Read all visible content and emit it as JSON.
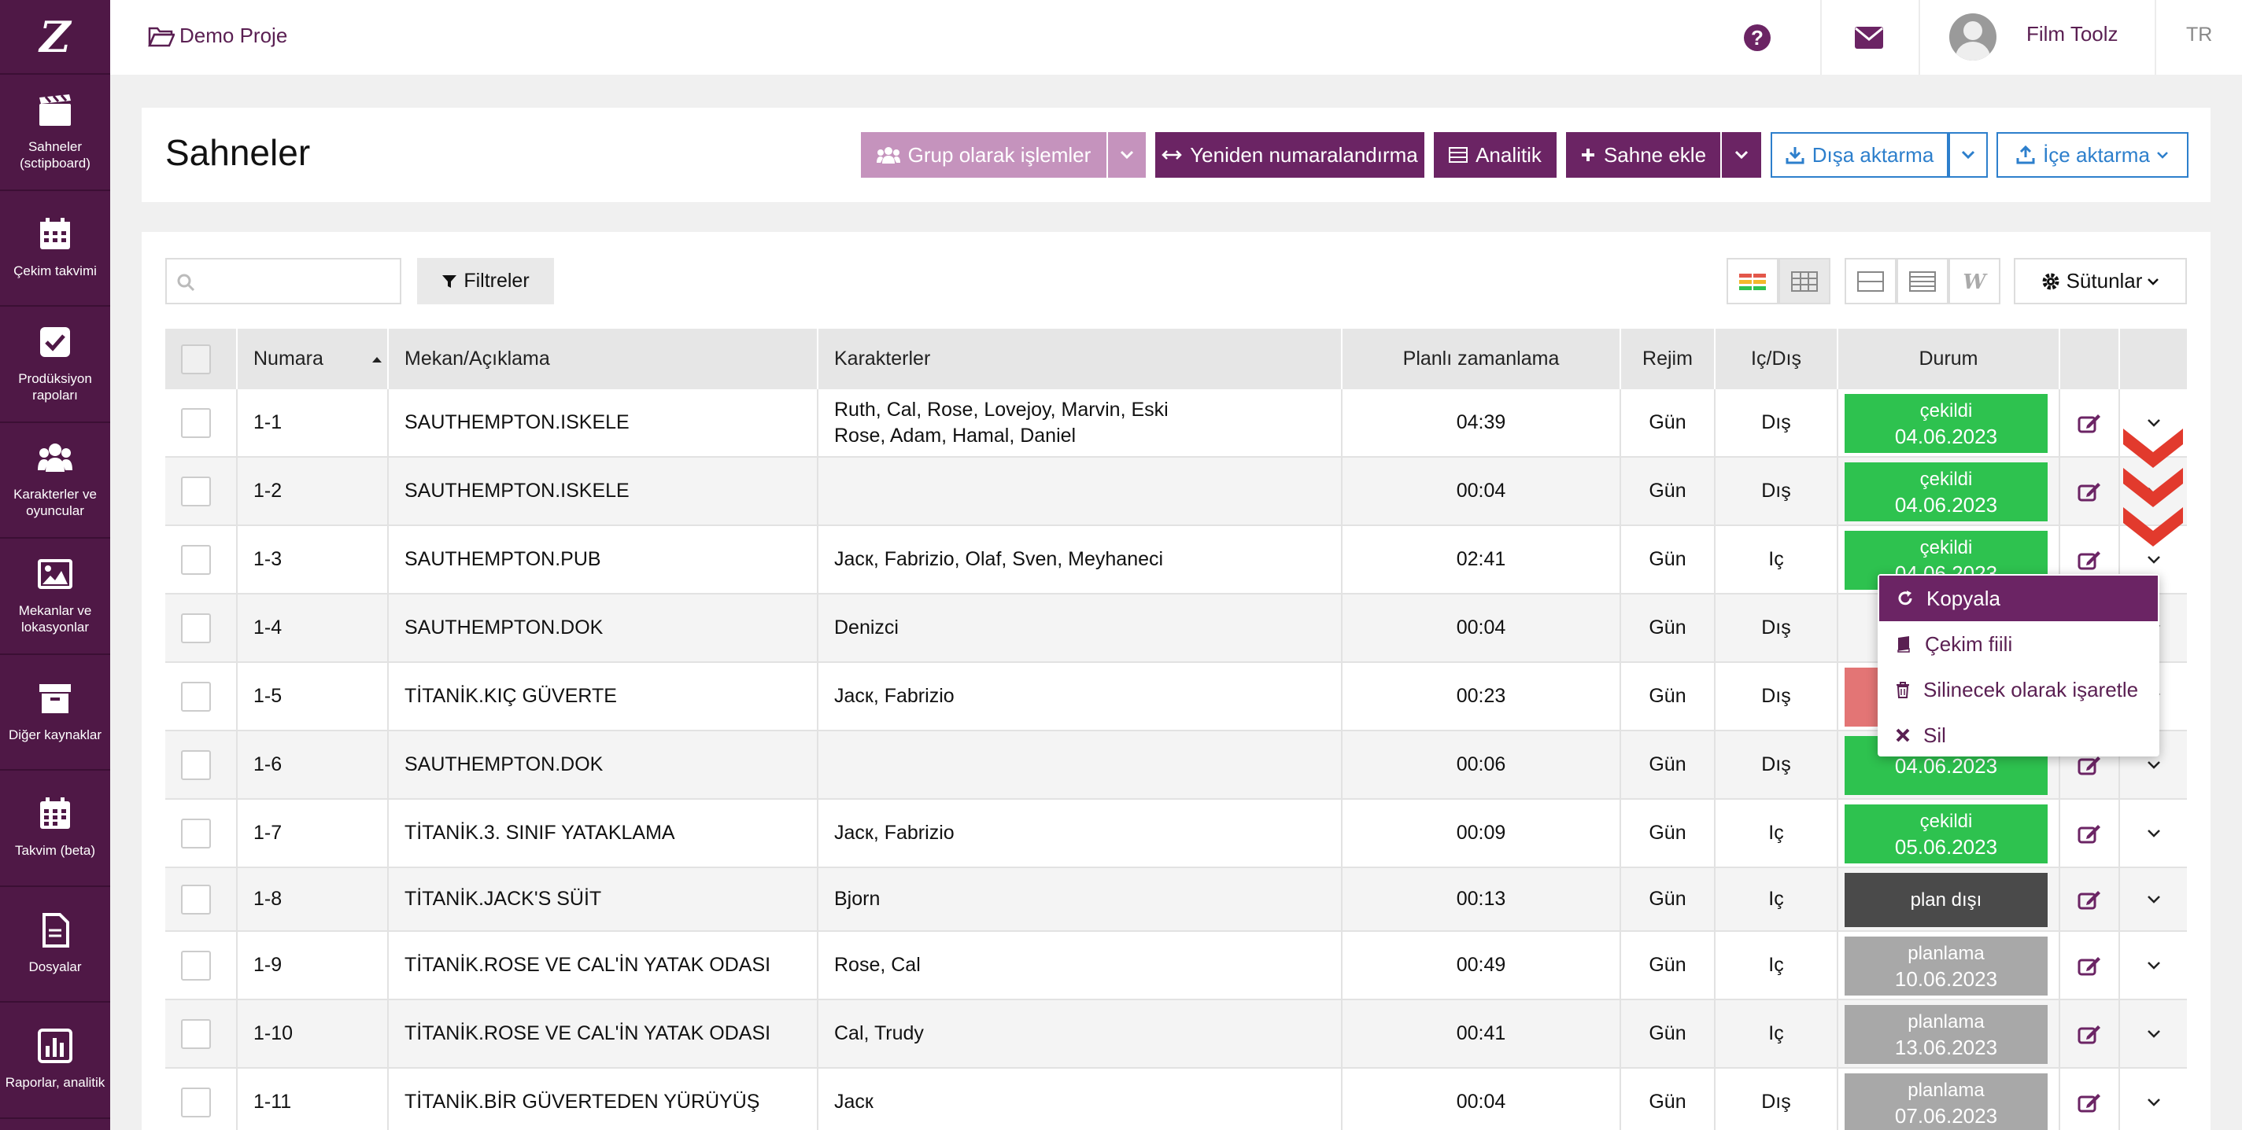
{
  "sidebar": {
    "logo": "Z",
    "items": [
      {
        "label": "Sahneler (sctipboard)",
        "icon": "clapperboard-icon"
      },
      {
        "label": "Çekim takvimi",
        "icon": "calendar-icon"
      },
      {
        "label": "Prodüksiyon rapoları",
        "icon": "checkbox-icon"
      },
      {
        "label": "Karakterler ve oyuncular",
        "icon": "users-icon"
      },
      {
        "label": "Mekanlar ve lokasyonlar",
        "icon": "image-icon"
      },
      {
        "label": "Diğer kaynaklar",
        "icon": "archive-icon"
      },
      {
        "label": "Takvim (beta)",
        "icon": "calendar-grid-icon"
      },
      {
        "label": "Dosyalar",
        "icon": "file-icon"
      },
      {
        "label": "Raporlar, analitik",
        "icon": "bar-chart-icon"
      }
    ]
  },
  "topbar": {
    "project": "Demo Proje",
    "user": "Film Toolz",
    "lang": "TR"
  },
  "header": {
    "title": "Sahneler",
    "group_ops": "Grup olarak işlemler",
    "renumber": "Yeniden numaralandırma",
    "analytics": "Analitik",
    "add_scene": "Sahne ekle",
    "export": "Dışa aktarma",
    "import": "İçe aktarma"
  },
  "toolbar": {
    "search_placeholder": "",
    "filters": "Filtreler",
    "columns": "Sütunlar"
  },
  "table": {
    "columns": [
      "Numara",
      "Mekan/Açıklama",
      "Karakterler",
      "Planlı zamanlama",
      "Rejim",
      "Iç/Dış",
      "Durum"
    ],
    "rows": [
      {
        "num": "1-1",
        "place": "SAUTHEMPTON.ISKELE",
        "chars1": "Ruth, Cal, Rose, Lovejoy, Marvin, Eski",
        "chars2": "Rose, Adam, Hamal, Daniel",
        "time": "04:39",
        "regime": "Gün",
        "io": "Dış",
        "status": "çekildi",
        "date": "04.06.2023"
      },
      {
        "num": "1-2",
        "place": "SAUTHEMPTON.ISKELE",
        "chars1": "",
        "chars2": "",
        "time": "00:04",
        "regime": "Gün",
        "io": "Dış",
        "status": "çekildi",
        "date": "04.06.2023"
      },
      {
        "num": "1-3",
        "place": "SAUTHEMPTON.PUB",
        "chars1": "Jacк, Fabrizio, Olaf, Sven, Meyhaneci",
        "chars2": "",
        "time": "02:41",
        "regime": "Gün",
        "io": "Iç",
        "status": "çekildi",
        "date": "04.06.2023"
      },
      {
        "num": "1-4",
        "place": "SAUTHEMPTON.DOK",
        "chars1": "Denizci",
        "chars2": "",
        "time": "00:04",
        "regime": "Gün",
        "io": "Dış",
        "status": "",
        "date": ""
      },
      {
        "num": "1-5",
        "place": "TİTANİK.KIÇ GÜVERTE",
        "chars1": "Jacк, Fabrizio",
        "chars2": "",
        "time": "00:23",
        "regime": "Gün",
        "io": "Dış",
        "status": "",
        "date": ""
      },
      {
        "num": "1-6",
        "place": "SAUTHEMPTON.DOK",
        "chars1": "",
        "chars2": "",
        "time": "00:06",
        "regime": "Gün",
        "io": "Dış",
        "status": "",
        "date": "04.06.2023"
      },
      {
        "num": "1-7",
        "place": "TİTANİK.3. SINIF YATAKLAMA",
        "chars1": "Jacк, Fabrizio",
        "chars2": "",
        "time": "00:09",
        "regime": "Gün",
        "io": "Iç",
        "status": "çekildi",
        "date": "05.06.2023"
      },
      {
        "num": "1-8",
        "place": "TİTANİK.JACK'S SÜİT",
        "chars1": "Bjorn",
        "chars2": "",
        "time": "00:13",
        "regime": "Gün",
        "io": "Iç",
        "status": "plan dışı",
        "date": ""
      },
      {
        "num": "1-9",
        "place": "TİTANİK.ROSE VE CAL'İN YATAK ODASI",
        "chars1": "Rose, Cal",
        "chars2": "",
        "time": "00:49",
        "regime": "Gün",
        "io": "Iç",
        "status": "planlama",
        "date": "10.06.2023"
      },
      {
        "num": "1-10",
        "place": "TİTANİK.ROSE VE CAL'İN YATAK ODASI",
        "chars1": "Cal, Trudy",
        "chars2": "",
        "time": "00:41",
        "regime": "Gün",
        "io": "Iç",
        "status": "planlama",
        "date": "13.06.2023"
      },
      {
        "num": "1-11",
        "place": "TİTANİK.BİR GÜVERTEDEN YÜRÜYÜŞ",
        "chars1": "Jacк",
        "chars2": "",
        "time": "00:04",
        "regime": "Gün",
        "io": "Dış",
        "status": "planlama",
        "date": "07.06.2023"
      }
    ]
  },
  "menu": {
    "copy": "Kopyala",
    "shoot_verb": "Çekim fiili",
    "mark_delete": "Silinecek olarak işaretle",
    "delete": "Sil"
  },
  "colors": {
    "sidebar": "#4f1846",
    "accent": "#6b2464",
    "shot": "#2ec24f",
    "unplanned": "#4a4a4a",
    "planning": "#a8a8a8",
    "error": "#e37575",
    "blue": "#2d7fcc"
  }
}
